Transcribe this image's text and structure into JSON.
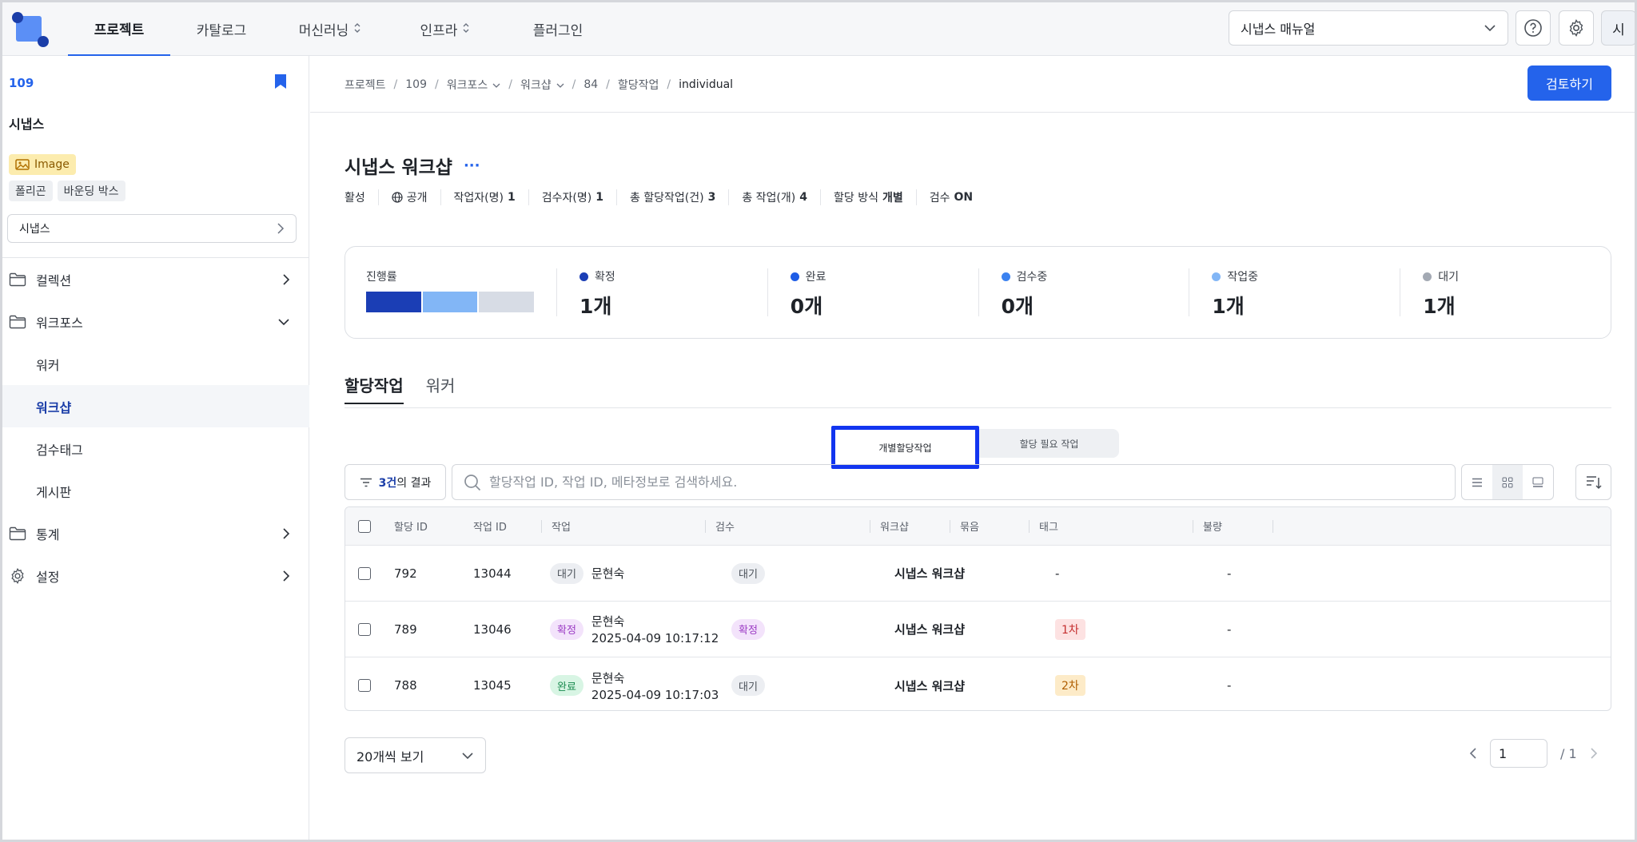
{
  "nav": {
    "items": [
      {
        "label": "프로젝트",
        "active": true,
        "chevron": false
      },
      {
        "label": "카탈로그",
        "active": false,
        "chevron": false
      },
      {
        "label": "머신러닝",
        "active": false,
        "chevron": true
      },
      {
        "label": "인프라",
        "active": false,
        "chevron": true
      },
      {
        "label": "플러그인",
        "active": false,
        "chevron": false
      }
    ],
    "manual_select": "시냅스 매뉴얼",
    "avatar": "시"
  },
  "sidebar": {
    "project_id": "109",
    "project_name": "시냅스",
    "data_type": "Image",
    "tags": [
      "폴리곤",
      "바운딩 박스"
    ],
    "select_label": "시냅스",
    "menu": [
      {
        "label": "컬렉션",
        "icon": "folder-icon",
        "chev": "›",
        "sub": false,
        "active": false
      },
      {
        "label": "워크포스",
        "icon": "folder-icon",
        "chev": "⌄",
        "sub": false,
        "active": false
      },
      {
        "label": "워커",
        "icon": "",
        "chev": "",
        "sub": true,
        "active": false
      },
      {
        "label": "워크샵",
        "icon": "",
        "chev": "",
        "sub": true,
        "active": true
      },
      {
        "label": "검수태그",
        "icon": "",
        "chev": "",
        "sub": true,
        "active": false
      },
      {
        "label": "게시판",
        "icon": "",
        "chev": "",
        "sub": true,
        "active": false
      },
      {
        "label": "통계",
        "icon": "folder-icon",
        "chev": "›",
        "sub": false,
        "active": false
      },
      {
        "label": "설정",
        "icon": "gear-icon",
        "chev": "›",
        "sub": false,
        "active": false
      }
    ]
  },
  "breadcrumb": [
    {
      "label": "프로젝트",
      "dropdown": false
    },
    {
      "label": "109",
      "dropdown": false
    },
    {
      "label": "워크포스",
      "dropdown": true
    },
    {
      "label": "워크샵",
      "dropdown": true
    },
    {
      "label": "84",
      "dropdown": false
    },
    {
      "label": "할당작업",
      "dropdown": false
    },
    {
      "label": "individual",
      "dropdown": false
    }
  ],
  "review_button": "검토하기",
  "workshop": {
    "title": "시냅스 워크샵",
    "more": "···",
    "meta": [
      {
        "label": "활성",
        "value": ""
      },
      {
        "label": "공개",
        "value": "",
        "icon": "globe-icon"
      },
      {
        "label": "작업자(명)",
        "value": "1"
      },
      {
        "label": "검수자(명)",
        "value": "1"
      },
      {
        "label": "총 할당작업(건)",
        "value": "3"
      },
      {
        "label": "총 작업(개)",
        "value": "4"
      },
      {
        "label": "할당 방식",
        "value": "개별"
      },
      {
        "label": "검수",
        "value": "ON"
      }
    ]
  },
  "stats": {
    "progress_label": "진행률",
    "progress_segments": [
      {
        "fraction": 0.333,
        "color": "#1b3eb5"
      },
      {
        "fraction": 0.333,
        "color": "#82b6f6"
      },
      {
        "fraction": 0.334,
        "color": "#d7dce5"
      }
    ],
    "items": [
      {
        "label": "확정",
        "value": "1개",
        "color": "#1b3eb5"
      },
      {
        "label": "완료",
        "value": "0개",
        "color": "#1e5de6"
      },
      {
        "label": "검수중",
        "value": "0개",
        "color": "#3b82f0"
      },
      {
        "label": "작업중",
        "value": "1개",
        "color": "#82b6f6"
      },
      {
        "label": "대기",
        "value": "1개",
        "color": "#a3a9b3"
      }
    ]
  },
  "tabs": [
    "할당작업",
    "워커"
  ],
  "segment": [
    "개별할당작업",
    "할당 필요 작업"
  ],
  "filter": {
    "count": "3건",
    "suffix": "의 결과"
  },
  "search": {
    "placeholder": "할당작업 ID, 작업 ID, 메타정보로 검색하세요."
  },
  "table": {
    "headers": [
      "할당 ID",
      "작업 ID",
      "작업",
      "검수",
      "워크샵",
      "묶음",
      "태그",
      "불량"
    ],
    "rows": [
      {
        "assign_id": "792",
        "task_id": "13044",
        "work_status": "대기",
        "work_status_class": "b-wait",
        "worker": "문현숙",
        "time": "",
        "review": "대기",
        "review_class": "b-wait",
        "workshop": "시냅스 워크샵",
        "bundle": "",
        "tag": "-",
        "tag_class": "",
        "defect": "-"
      },
      {
        "assign_id": "789",
        "task_id": "13046",
        "work_status": "확정",
        "work_status_class": "b-conf",
        "worker": "문현숙",
        "time": "2025-04-09 10:17:12",
        "review": "확정",
        "review_class": "b-conf",
        "workshop": "시냅스 워크샵",
        "bundle": "",
        "tag": "1차",
        "tag_class": "t-1",
        "defect": "-"
      },
      {
        "assign_id": "788",
        "task_id": "13045",
        "work_status": "완료",
        "work_status_class": "b-done",
        "worker": "문현숙",
        "time": "2025-04-09 10:17:03",
        "review": "대기",
        "review_class": "b-wait",
        "workshop": "시냅스 워크샵",
        "bundle": "",
        "tag": "2차",
        "tag_class": "t-2",
        "defect": "-"
      }
    ]
  },
  "pagination": {
    "page_size": "20개씩 보기",
    "current": "1",
    "total": "/ 1"
  }
}
